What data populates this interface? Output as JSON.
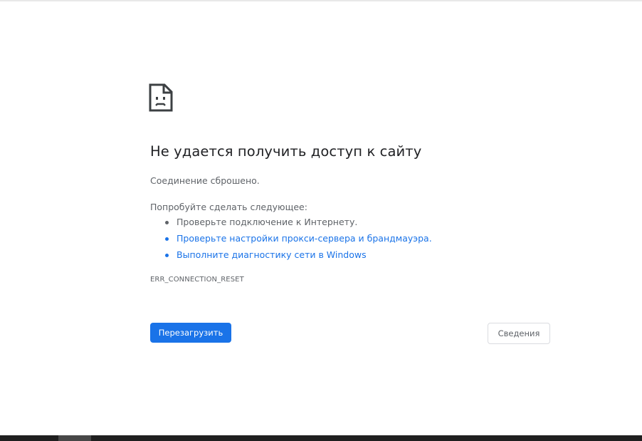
{
  "error_page": {
    "icon": "sad-page-icon",
    "title": "Не удается получить доступ к сайту",
    "subtitle": "Соединение сброшено.",
    "try_label": "Попробуйте сделать следующее:",
    "suggestions": [
      {
        "text": "Проверьте подключение к Интернету.",
        "is_link": false
      },
      {
        "text": "Проверьте настройки прокси-сервера и брандмауэра.",
        "is_link": true
      },
      {
        "text": "Выполните диагностику сети в Windows",
        "is_link": true
      }
    ],
    "error_code": "ERR_CONNECTION_RESET",
    "reload_label": "Перезагрузить",
    "details_label": "Сведения"
  },
  "colors": {
    "accent": "#1a73e8",
    "text_primary": "#202124",
    "text_secondary": "#5f6368",
    "button_border": "#dadce0",
    "taskbar": "#1f1f1f"
  }
}
